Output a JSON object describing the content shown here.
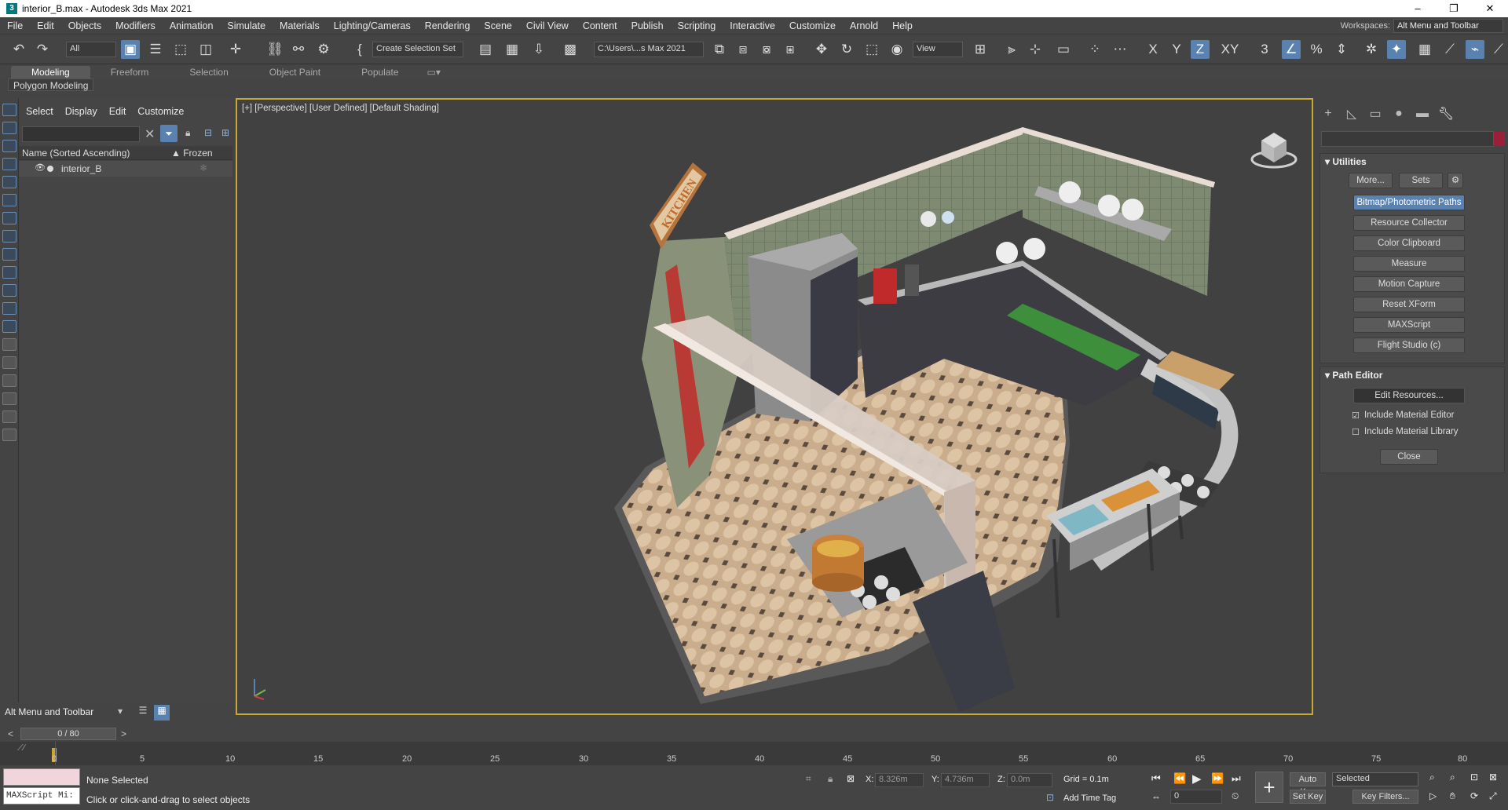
{
  "window": {
    "title": "interior_B.max - Autodesk 3ds Max 2021",
    "minimize": "–",
    "maximize": "❐",
    "close": "✕"
  },
  "menu": [
    "File",
    "Edit",
    "Objects",
    "Modifiers",
    "Animation",
    "Simulate",
    "Materials",
    "Lighting/Cameras",
    "Rendering",
    "Scene",
    "Civil View",
    "Content",
    "Publish",
    "Scripting",
    "Interactive",
    "Customize",
    "Arnold",
    "Help"
  ],
  "workspace": {
    "label": "Workspaces:",
    "value": "Alt Menu and Toolbar"
  },
  "toolbar": {
    "filter": "All",
    "selection_set": "Create Selection Set",
    "project_path": "C:\\Users\\...s Max 2021",
    "view": "View",
    "axes": [
      "X",
      "Y",
      "Z",
      "XY"
    ]
  },
  "ribbon": {
    "tabs": [
      "Modeling",
      "Freeform",
      "Selection",
      "Object Paint",
      "Populate"
    ],
    "active_panel": "Polygon Modeling"
  },
  "scene_explorer": {
    "menu": [
      "Select",
      "Display",
      "Edit",
      "Customize"
    ],
    "column_name": "Name (Sorted Ascending)",
    "column_frozen": "▲ Frozen",
    "rows": [
      {
        "name": "interior_B"
      }
    ],
    "layer_label": "Alt Menu and Toolbar"
  },
  "viewport": {
    "label": "[+] [Perspective] [User Defined] [Default Shading]",
    "sign": "KITCHEN"
  },
  "command_panel": {
    "utilities_title": "Utilities",
    "more_btn": "More...",
    "sets_btn": "Sets",
    "buttons": [
      "Bitmap/Photometric Paths",
      "Resource Collector",
      "Color Clipboard",
      "Measure",
      "Motion Capture",
      "Reset XForm",
      "MAXScript",
      "Flight Studio (c)"
    ],
    "path_editor_title": "Path Editor",
    "edit_resources": "Edit Resources...",
    "include_material_editor": "Include Material Editor",
    "include_material_library": "Include Material Library",
    "close": "Close"
  },
  "timeline": {
    "frame": "0 / 80",
    "ticks": [
      "0",
      "5",
      "10",
      "15",
      "20",
      "25",
      "30",
      "35",
      "40",
      "45",
      "50",
      "55",
      "60",
      "65",
      "70",
      "75",
      "80"
    ]
  },
  "status": {
    "maxscript": "MAXScript Mi:",
    "selection": "None Selected",
    "hint": "Click or click-and-drag to select objects",
    "x_label": "X:",
    "x_value": "8.326m",
    "y_label": "Y:",
    "y_value": "4.736m",
    "z_label": "Z:",
    "z_value": "0.0m",
    "grid": "Grid = 0.1m",
    "add_time_tag": "Add Time Tag",
    "auto_key": "Auto Key",
    "set_key": "Set Key",
    "key_mode": "Selected",
    "key_filters": "Key Filters...",
    "current_frame": "0"
  }
}
